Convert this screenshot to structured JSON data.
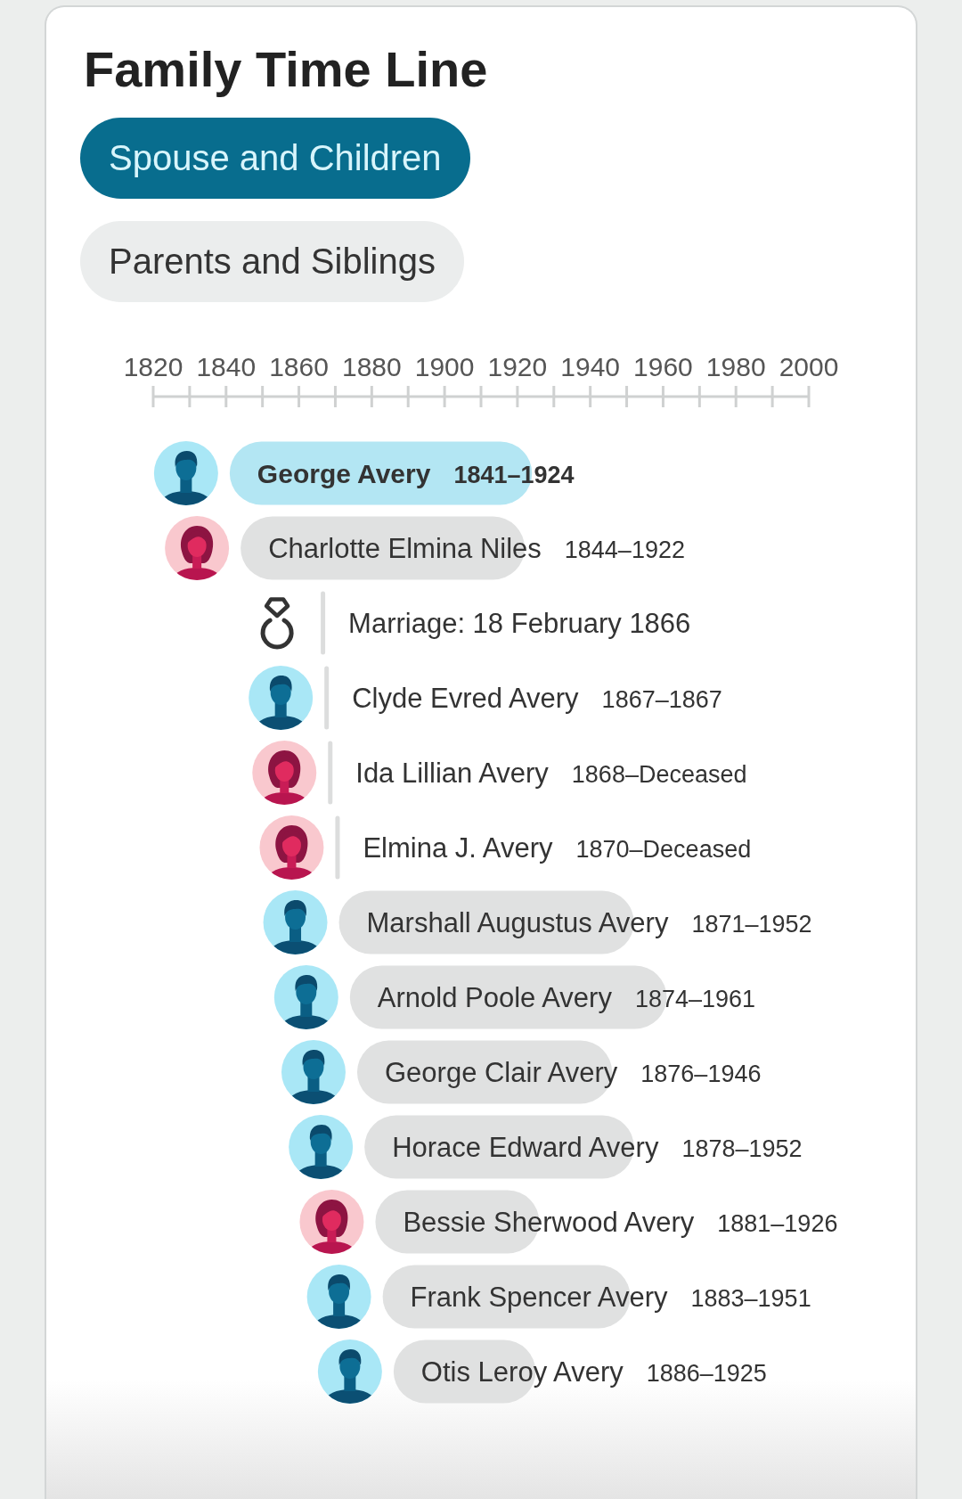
{
  "title": "Family Time Line",
  "tabs": [
    {
      "label": "Spouse and Children",
      "selected": true
    },
    {
      "label": "Parents and Siblings",
      "selected": false
    }
  ],
  "timeline": {
    "axis": {
      "labels": [
        "1820",
        "1840",
        "1860",
        "1880",
        "1900",
        "1920",
        "1940",
        "1960",
        "1980",
        "2000"
      ]
    },
    "rows": [
      {
        "kind": "person",
        "female": false,
        "name": "George Avery",
        "dates": "1841–1924",
        "highlighted": true
      },
      {
        "kind": "person",
        "female": true,
        "name": "Charlotte Elmina Niles",
        "dates": "1844–1922",
        "highlighted": false
      },
      {
        "kind": "event",
        "label": "Marriage: 18 February 1866",
        "highlighted": false
      },
      {
        "kind": "person",
        "female": false,
        "name": "Clyde Evred Avery",
        "dates": "1867–1867",
        "highlighted": false
      },
      {
        "kind": "person",
        "female": true,
        "name": "Ida Lillian Avery",
        "dates": "1868–Deceased",
        "highlighted": false
      },
      {
        "kind": "person",
        "female": true,
        "name": "Elmina J. Avery",
        "dates": "1870–Deceased",
        "highlighted": false
      },
      {
        "kind": "person",
        "female": false,
        "name": "Marshall Augustus Avery",
        "dates": "1871–1952",
        "highlighted": false
      },
      {
        "kind": "person",
        "female": false,
        "name": "Arnold Poole Avery",
        "dates": "1874–1961",
        "highlighted": false
      },
      {
        "kind": "person",
        "female": false,
        "name": "George Clair Avery",
        "dates": "1876–1946",
        "highlighted": false
      },
      {
        "kind": "person",
        "female": false,
        "name": "Horace Edward Avery",
        "dates": "1878–1952",
        "highlighted": false
      },
      {
        "kind": "person",
        "female": true,
        "name": "Bessie Sherwood Avery",
        "dates": "1881–1926",
        "highlighted": false
      },
      {
        "kind": "person",
        "female": false,
        "name": "Frank Spencer Avery",
        "dates": "1883–1951",
        "highlighted": false
      },
      {
        "kind": "person",
        "female": false,
        "name": "Otis Leroy Avery",
        "dates": "1886–1925",
        "highlighted": false
      }
    ]
  }
}
